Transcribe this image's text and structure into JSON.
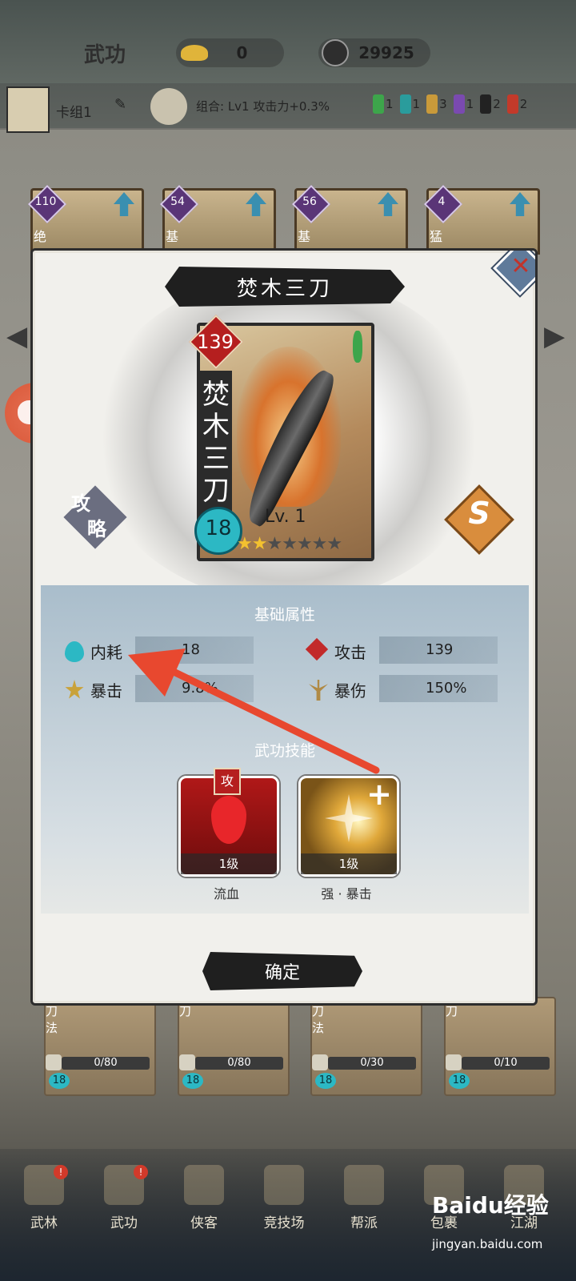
{
  "header": {
    "title": "武功",
    "currency_gold": "0",
    "currency_coin": "29925"
  },
  "deck": {
    "label": "卡组1",
    "combo_text": "组合: Lv1 攻击力+0.3%",
    "elements": [
      {
        "icon": "green-sword-icon",
        "count": "1",
        "color": "#3da54b"
      },
      {
        "icon": "teal-sword-icon",
        "count": "1",
        "color": "#2a9c9c"
      },
      {
        "icon": "gold-fist-icon",
        "count": "3",
        "color": "#c99a3a"
      },
      {
        "icon": "purple-mask-icon",
        "count": "1",
        "color": "#7a4ab0"
      },
      {
        "icon": "yin-yang-icon",
        "count": "2",
        "color": "#222222"
      },
      {
        "icon": "red-blade-icon",
        "count": "2",
        "color": "#c33a2a"
      }
    ]
  },
  "background_cards": [
    {
      "badge": "110",
      "label": "绝"
    },
    {
      "badge": "54",
      "label": "基"
    },
    {
      "badge": "56",
      "label": "基"
    },
    {
      "badge": "4",
      "label": "猛"
    }
  ],
  "lower_cards": [
    {
      "label": "刀法",
      "progress": "0/80",
      "cost": "18"
    },
    {
      "label": "刀",
      "progress": "0/80",
      "cost": "18"
    },
    {
      "label": "刀法",
      "progress": "0/30",
      "cost": "18"
    },
    {
      "label": "刀",
      "progress": "0/10",
      "cost": "18"
    }
  ],
  "modal": {
    "title": "焚木三刀",
    "card": {
      "power": "139",
      "name_vertical": "焚木三刀",
      "level": "Lv. 1",
      "cost": "18",
      "stars_filled": 2,
      "stars_total": 7
    },
    "guide_label": "攻略",
    "s_label": "S",
    "attr_section_title": "基础属性",
    "stats": [
      {
        "icon": "water-drop-icon",
        "label": "内耗",
        "value": "18"
      },
      {
        "icon": "red-diamond-icon",
        "label": "攻击",
        "value": "139"
      },
      {
        "icon": "crit-burst-icon",
        "label": "暴击",
        "value": "9.8%"
      },
      {
        "icon": "trident-icon",
        "label": "暴伤",
        "value": "150%"
      }
    ],
    "skill_section_title": "武功技能",
    "skills": [
      {
        "name": "流血",
        "level": "1级",
        "tag": "攻"
      },
      {
        "name": "强 · 暴击",
        "level": "1级",
        "tag": "+"
      }
    ],
    "confirm_label": "确定"
  },
  "navbar": [
    {
      "label": "武林",
      "badge": "!"
    },
    {
      "label": "武功",
      "badge": "!"
    },
    {
      "label": "侠客",
      "badge": ""
    },
    {
      "label": "竞技场",
      "badge": ""
    },
    {
      "label": "帮派",
      "badge": ""
    },
    {
      "label": "包裹",
      "badge": ""
    },
    {
      "label": "江湖",
      "badge": ""
    }
  ],
  "watermark": {
    "brand": "Baidu经验",
    "url": "jingyan.baidu.com"
  },
  "colors": {
    "arrow": "#e8482f",
    "power_red": "#b51f1f",
    "cost_teal": "#2cb8c4",
    "star_gold": "#f3c12f"
  }
}
